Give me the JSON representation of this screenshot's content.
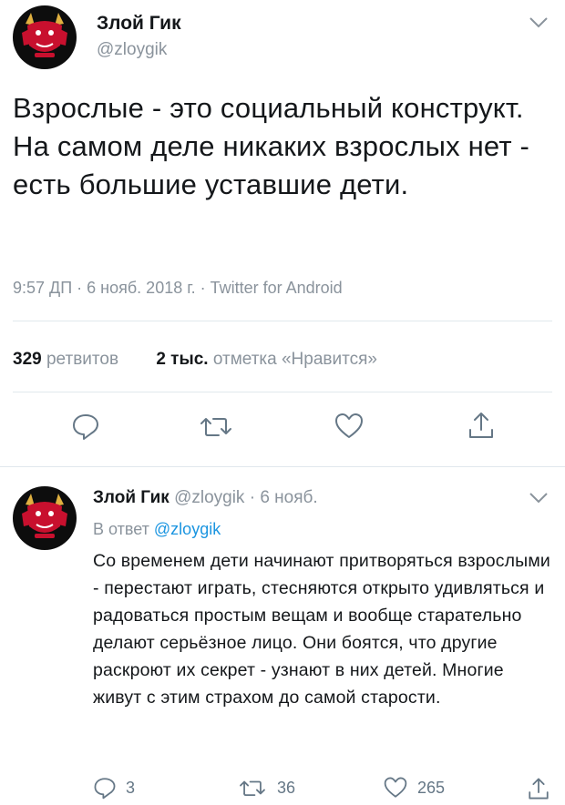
{
  "tweet": {
    "author_name": "Злой Гик",
    "author_handle": "@zloygik",
    "text": "Взрослые - это социальный конструкт. На самом деле никаких взрослых нет - есть большие уставшие дети.",
    "meta": "9:57 ДП · 6 нояб. 2018 г. · Twitter for Android",
    "stats": {
      "retweets_count": "329",
      "retweets_label": "ретвитов",
      "likes_count": "2 тыс.",
      "likes_label": "отметка «Нравится»"
    },
    "actions": [
      "reply-icon",
      "retweet-icon",
      "heart-icon",
      "share-icon"
    ]
  },
  "reply": {
    "author_name": "Злой Гик",
    "author_handle": "@zloygik",
    "separator": "·",
    "date": "6 нояб.",
    "reply_to_label": "В ответ",
    "reply_to_handle": "@zloygik",
    "text": "Со временем дети начинают притворяться взрослыми - перестают играть, стесняются открыто удивляться и радоваться простым вещам и вообще старательно делают серьёзное лицо. Они боятся, что другие раскроют их секрет - узнают в них детей. Многие живут с этим страхом до самой старости.",
    "counts": {
      "replies": "3",
      "retweets": "36",
      "likes": "265"
    }
  },
  "colors": {
    "text": "#14171a",
    "muted": "#8a939c",
    "link": "#1b95e0",
    "divider": "#e1e8ed",
    "avatar_bg": "#0d0d0d",
    "avatar_accent": "#c8102e"
  }
}
